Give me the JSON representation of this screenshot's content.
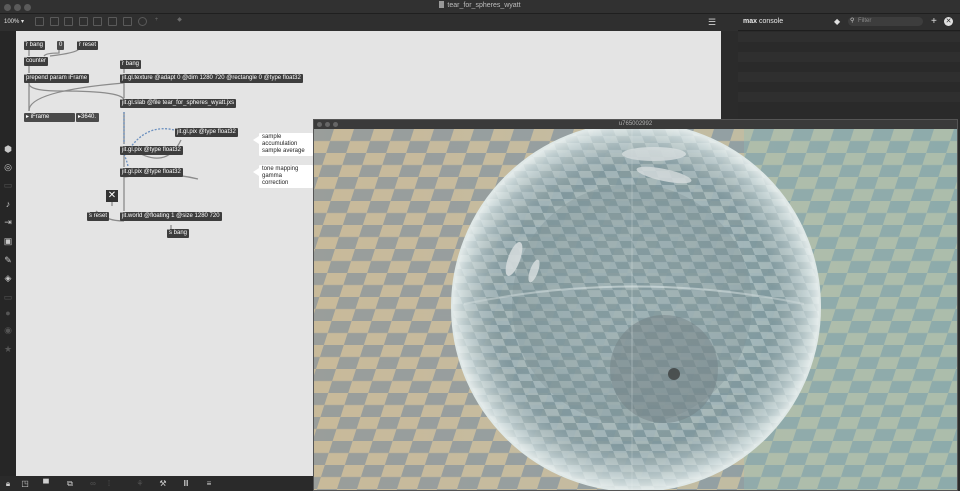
{
  "window": {
    "title": "tear_for_spheres_wyatt"
  },
  "toolbar": {
    "zoom": "100%",
    "zoom_caret": "▾"
  },
  "patch": {
    "r_bang_top": "r bang",
    "number_box": "0",
    "r_reset": "r reset",
    "counter": "counter",
    "prepend": "prepend param iFrame",
    "r_bang_right": "r bang",
    "jit_texture": "jit.gl.texture @adapt 0 @dim 1280 720 @rectangle 0 @type float32",
    "jit_slab": "jit.gl.slab @file tear_for_spheres_wyatt.jxs",
    "iframe_label": "iFrame",
    "iframe_value": "3640.",
    "pix_feedback": "jit.gl.pix @type float32",
    "pix_accumulate": "jit.gl.pix @type float32",
    "pix_tonemap": "jit.gl.pix @type float32",
    "comment_accum_1": "sample accumulation",
    "comment_accum_2": "sample average",
    "comment_tone_1": "tone mapping",
    "comment_tone_2": "gamma correction",
    "s_reset": "s reset",
    "jit_world": "jit.world @floating 1 @size 1280 720",
    "s_bang": "s bang",
    "close_glyph": "✕"
  },
  "console": {
    "title_bold": "max",
    "title_rest": " console",
    "filter_placeholder": "Filter"
  },
  "render_window": {
    "title": "u765002992"
  },
  "colors": {
    "canvas": "#e4e4e4",
    "object": "#3d3d3d",
    "chrome": "#2b2b2b"
  }
}
